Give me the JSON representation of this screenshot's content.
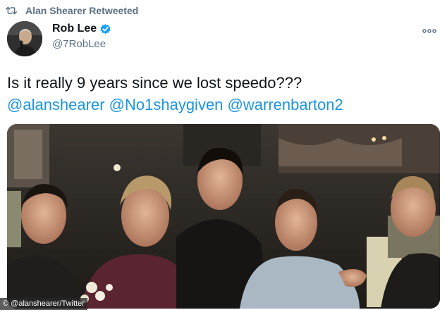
{
  "retweet": {
    "icon": "retweet-icon",
    "text": "Alan Shearer Retweeted"
  },
  "author": {
    "display_name": "Rob Lee",
    "handle": "@7RobLee",
    "verified": true,
    "verified_color": "#1da1f2"
  },
  "tweet": {
    "text": "Is it really 9 years since we lost speedo???",
    "mentions": [
      "@alanshearer",
      "@No1shaygiven",
      "@warrenbarton2"
    ],
    "mention_color": "#1b95e0"
  },
  "photo": {
    "icon": "group-photo"
  },
  "credit": "© @alanshearer/Twitter",
  "more_icon": "more-horizontal-icon"
}
